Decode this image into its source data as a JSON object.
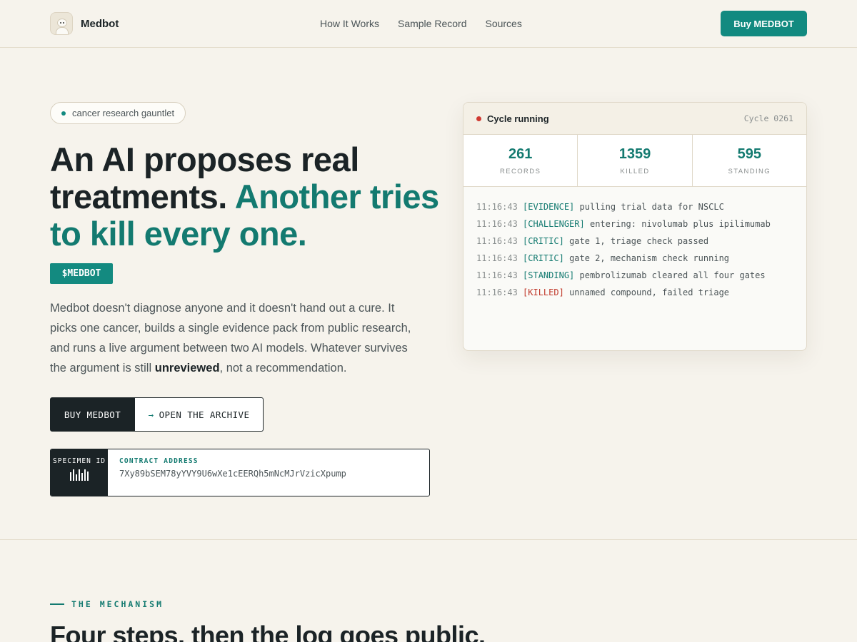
{
  "header": {
    "brand": "Medbot",
    "nav": [
      "How It Works",
      "Sample Record",
      "Sources"
    ],
    "buy_button": "Buy MEDBOT"
  },
  "hero": {
    "pill": "cancer research gauntlet",
    "headline_part1": "An AI proposes real treatments.",
    "headline_accent": "Another tries to kill every one.",
    "ticker": "$MEDBOT",
    "desc_before": "Medbot doesn't diagnose anyone and it doesn't hand out a cure. It picks one cancer, builds a single evidence pack from public research, and runs a live argument between two AI models. Whatever survives the argument is still ",
    "desc_bold": "unreviewed",
    "desc_after": ", not a recommendation.",
    "btn_primary": "BUY MEDBOT",
    "btn_secondary": "OPEN THE ARCHIVE",
    "specimen_label": "SPECIMEN ID",
    "contract_label": "CONTRACT ADDRESS",
    "contract_address": "7Xy89bSEM78yYVY9U6wXe1cEERQh5mNcMJrVzicXpump"
  },
  "console": {
    "status": "Cycle running",
    "cycle": "Cycle 0261",
    "stats": [
      {
        "value": "261",
        "label": "RECORDS"
      },
      {
        "value": "1359",
        "label": "KILLED"
      },
      {
        "value": "595",
        "label": "STANDING"
      }
    ],
    "log": [
      {
        "time": "11:16:43",
        "tag": "[EVIDENCE]",
        "msg": "pulling trial data for NSCLC"
      },
      {
        "time": "11:16:43",
        "tag": "[CHALLENGER]",
        "msg": "entering: nivolumab plus ipilimumab"
      },
      {
        "time": "11:16:43",
        "tag": "[CRITIC]",
        "msg": "gate 1, triage check passed"
      },
      {
        "time": "11:16:43",
        "tag": "[CRITIC]",
        "msg": "gate 2, mechanism check running"
      },
      {
        "time": "11:16:43",
        "tag": "[STANDING]",
        "msg": "pembrolizumab cleared all four gates"
      },
      {
        "time": "11:16:43",
        "tag": "[KILLED]",
        "msg": "unnamed compound, failed triage"
      }
    ]
  },
  "mechanism": {
    "eyebrow": "THE MECHANISM",
    "title": "Four steps, then the log goes public."
  },
  "colors": {
    "background": "#f6f3ec",
    "accent": "#128a80",
    "dark": "#1b2326",
    "killed": "#c0392b"
  }
}
